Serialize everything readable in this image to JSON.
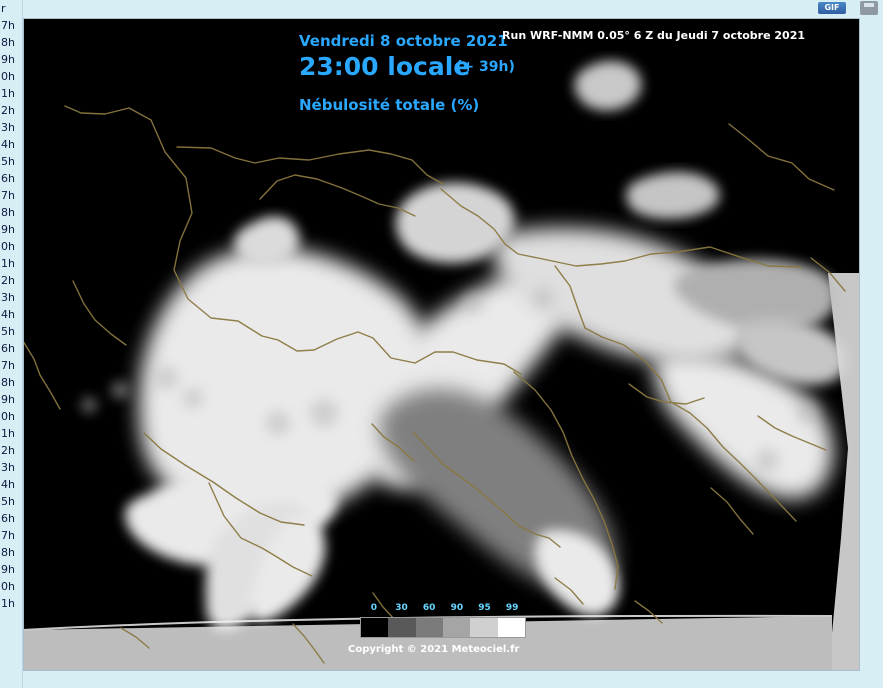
{
  "left_times": [
    "r",
    "7h",
    "8h",
    "9h",
    "0h",
    "1h",
    "2h",
    "3h",
    "4h",
    "5h",
    "6h",
    "7h",
    "8h",
    "9h",
    "0h",
    "1h",
    "2h",
    "3h",
    "4h",
    "5h",
    "6h",
    "7h",
    "8h",
    "9h",
    "0h",
    "1h",
    "2h",
    "3h",
    "4h",
    "5h",
    "6h",
    "7h",
    "8h",
    "9h",
    "0h",
    "1h"
  ],
  "toolbar": {
    "gif_label": "GIF",
    "save_icon": "save-icon"
  },
  "map": {
    "date_line": "Vendredi 8 octobre 2021",
    "time_line": "23:00 locale",
    "offset_line": "(+ 39h)",
    "parameter_line": "Nébulosité totale (%)",
    "run_line": "Run WRF-NMM 0.05° 6 Z du Jeudi 7 octobre 2021",
    "copyright": "Copyright © 2021 Meteociel.fr"
  },
  "legend": {
    "labels": [
      "0",
      "30",
      "60",
      "90",
      "95",
      "99"
    ],
    "colors": [
      "#000000",
      "#595959",
      "#7b7b7b",
      "#a5a5a5",
      "#d0d0d0",
      "#ffffff"
    ]
  },
  "colors": {
    "background": "#d8eef5",
    "map_background": "#000000",
    "title_blue": "#2aa8ff",
    "legend_blue": "#67d7ff",
    "border_line": "#8a7840"
  }
}
